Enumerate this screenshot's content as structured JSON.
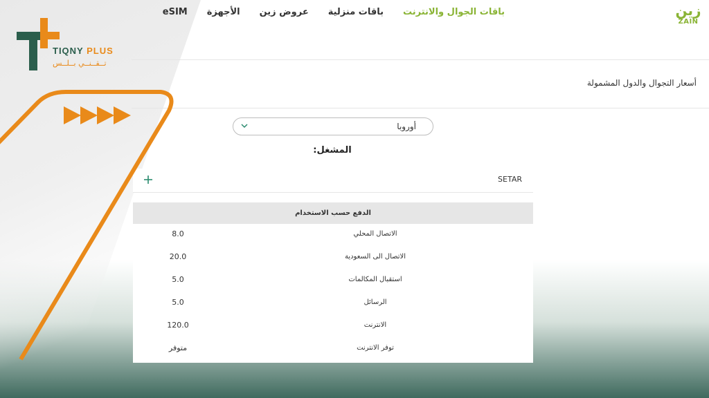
{
  "brand": {
    "zain_arabic": "زين",
    "zain_latin": "ZAIN",
    "tiqny_latin_1": "TIQNY",
    "tiqny_latin_2": "PLUS",
    "tiqny_arabic": "تــقــنــي بــلــس"
  },
  "nav": {
    "items": [
      {
        "label": "باقات الجوال والانترنت",
        "active": true
      },
      {
        "label": "باقات منزلية",
        "active": false
      },
      {
        "label": "عروض زين",
        "active": false
      },
      {
        "label": "الأجهزة",
        "active": false
      },
      {
        "label": "eSIM",
        "active": false
      }
    ]
  },
  "page": {
    "title": "أسعار التجوال والدول المشمولة"
  },
  "region_select": {
    "selected": "أوروبا",
    "icon": "chevron-down-icon"
  },
  "operator": {
    "label": "المشغل:",
    "name": "SETAR",
    "expand_icon": "plus-icon"
  },
  "rates": {
    "header": "الدفع حسب الاستخدام",
    "rows": [
      {
        "label": "الاتصال المحلي",
        "value": "8.0"
      },
      {
        "label": "الاتصال الى السعودية",
        "value": "20.0"
      },
      {
        "label": "استقبال المكالمات",
        "value": "5.0"
      },
      {
        "label": "الرسائل",
        "value": "5.0"
      },
      {
        "label": "الانترنت",
        "value": "120.0"
      },
      {
        "label": "توفر الانترنت",
        "value": "متوفر"
      }
    ]
  },
  "colors": {
    "zain_green": "#8ab435",
    "tiqny_green": "#2b5e4c",
    "tiqny_orange": "#e98a1a",
    "accent_teal": "#2a8a6e"
  }
}
